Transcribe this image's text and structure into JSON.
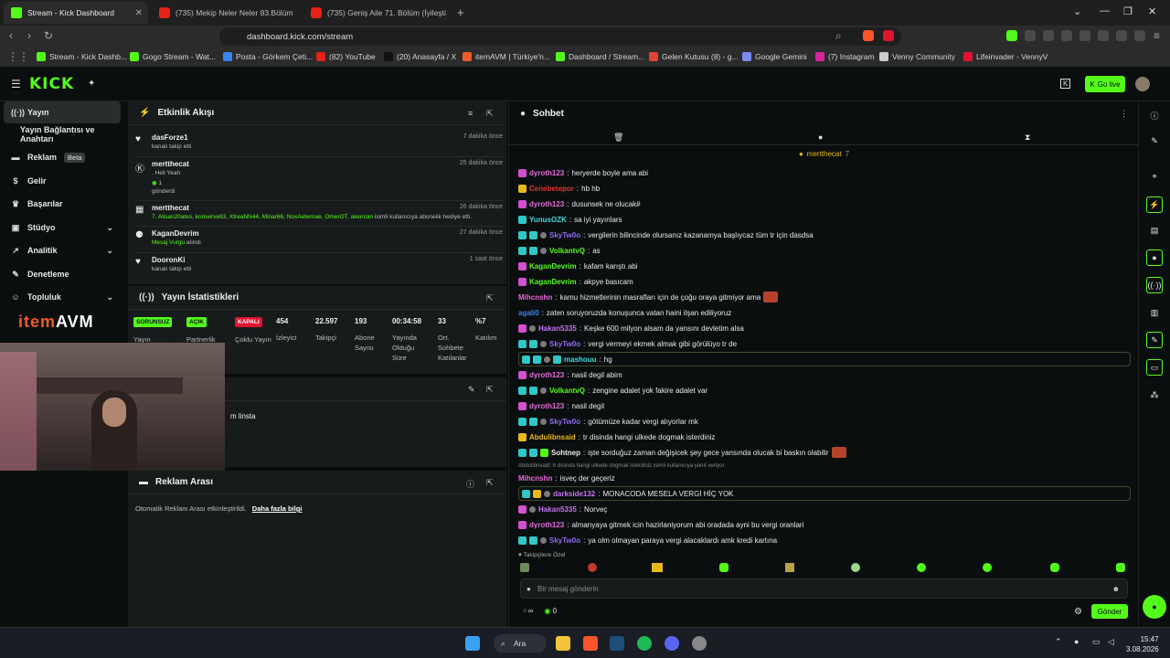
{
  "browser": {
    "tabs": [
      {
        "title": "Stream - Kick Dashboard",
        "icon": "kick-icon",
        "active": true
      },
      {
        "title": "(735) Mekip Neler Neler 83.Bölüm İz",
        "icon": "youtube-icon",
        "active": false
      },
      {
        "title": "(735) Geniş Aile 71. Bölüm (İyileştirile",
        "icon": "youtube-icon",
        "active": false
      }
    ],
    "url": "dashboard.kick.com/stream",
    "bookmarks": [
      "Stream - Kick Dashb...",
      "Gogo Stream - Wat...",
      "Posta - Görkem Çeti...",
      "(82) YouTube",
      "(20) Anasayfa / X",
      "itemAVM | Türkiye'n...",
      "Dashboard / Stream...",
      "Gelen Kutusu (8) - g...",
      "Google Gemini",
      "(7) Instagram",
      "Venny Community",
      "Lifeinvader - VennyV"
    ]
  },
  "header": {
    "logo": "KICK",
    "go_live": "Go live"
  },
  "sidebar": {
    "items": [
      {
        "label": "Yayın",
        "icon": "broadcast-icon"
      },
      {
        "label": "Yayın Bağlantısı ve Anahtarı",
        "icon": ""
      },
      {
        "label": "Reklam",
        "icon": "ad-icon",
        "badge": "Beta"
      },
      {
        "label": "Gelir",
        "icon": "dollar-icon"
      },
      {
        "label": "Başarılar",
        "icon": "trophy-icon"
      },
      {
        "label": "Stüdyo",
        "icon": "studio-icon"
      },
      {
        "label": "Analitik",
        "icon": "chart-icon"
      },
      {
        "label": "Denetleme",
        "icon": "wrench-icon"
      },
      {
        "label": "Topluluk",
        "icon": "community-icon"
      }
    ]
  },
  "activity": {
    "title": "Etkinlik Akışı",
    "items": [
      {
        "name": "dasForze1",
        "time": "7 dakika önce",
        "sub": "kanalı takip etti",
        "icon": "heart-icon"
      },
      {
        "name": "mertthecat",
        "time": "25 dakika önce",
        "sub1": ". Hell Yeah",
        "sub2": "1",
        "sub3": "gönderdi",
        "icon": "kick-icon"
      },
      {
        "name": "mertthecat",
        "time": "26 dakika önce",
        "users": "7, Alisan20ates, konserve63, XtreaNN44, Minar66, NoxAeternae, OmerOT, awurcan",
        "sub": " isimli kullanıcıya abonelik hediye etti.",
        "icon": "gift-icon"
      },
      {
        "name": "KaganDevrim",
        "time": "27 dakika önce",
        "reward": "Mesaj Vurgu",
        "sub": " alındı",
        "icon": "reward-icon"
      },
      {
        "name": "DooronKi",
        "time": "1 saat önce",
        "sub": "kanalı takip etti",
        "icon": "heart-icon"
      }
    ]
  },
  "stats": {
    "title": "Yayın İstatistikleri",
    "pills": [
      {
        "text": "SORUNSUZ",
        "label": "Yayın",
        "color": "#53fc18"
      },
      {
        "text": "AÇIK",
        "label": "Partnerlik",
        "color": "#53fc18"
      },
      {
        "text": "KAPALI",
        "label": "Çoklu Yayın",
        "color": "#e0142f"
      }
    ],
    "values": [
      {
        "value": "454",
        "label": "İzleyici"
      },
      {
        "value": "22.597",
        "label": "Takipçi"
      },
      {
        "value": "193",
        "label": "Abone Sayısı"
      },
      {
        "value": "00:34:58",
        "label": "Yayında Olduğu Süre"
      },
      {
        "value": "33",
        "label": "Ort. Sohbete Katılanlar"
      },
      {
        "value": "%7",
        "label": "Katılım"
      }
    ]
  },
  "info_panel": {
    "text": "m linsta"
  },
  "ads": {
    "title": "Reklam Arası",
    "text": "Otomatik Reklam Arası etkinleştirildi.",
    "link": "Daha fazla bilgi"
  },
  "overlay": {
    "logo_item": "item",
    "logo_avm": "AVM"
  },
  "chat": {
    "title": "Sohbet",
    "pinned_user": "mertthecat",
    "pinned_count": "7",
    "messages": [
      {
        "user": "dyroth123",
        "color": "#e46cd7",
        "badges": [
          "pink"
        ],
        "text": "heryerde boyle ama abi"
      },
      {
        "user": "Cenebetepor",
        "color": "#e2362f",
        "badges": [
          "gold"
        ],
        "text": "hb hb"
      },
      {
        "user": "dyroth123",
        "color": "#e46cd7",
        "badges": [
          "pink"
        ],
        "text": "dusunsek ne olucak#"
      },
      {
        "user": "YunusOZK",
        "color": "#45d9e0",
        "badges": [
          "teal"
        ],
        "text": "sa iyi yayınlars"
      },
      {
        "user": "SkyTw0o",
        "color": "#8f6bf0",
        "badges": [
          "teal",
          "teal",
          "grey"
        ],
        "text": "vergilerin bilincinde olursanız kazanamya başlıycaz tüm tr için dasdsa"
      },
      {
        "user": "VolkantvQ",
        "color": "#53fc18",
        "badges": [
          "teal",
          "teal",
          "grey"
        ],
        "text": "as"
      },
      {
        "user": "KaganDevrim",
        "color": "#53fc18",
        "badges": [
          "pink"
        ],
        "text": "kafam karıştı abi"
      },
      {
        "user": "KaganDevrim",
        "color": "#53fc18",
        "badges": [
          "pink"
        ],
        "text": "akpye basıcam"
      },
      {
        "user": "Mihcnshn",
        "color": "#e46cd7",
        "badges": [],
        "text": "kamu hizmetlerinin masrafları için de çoğu oraya gitmiyor ama"
      },
      {
        "user": "agali0",
        "color": "#3b83f0",
        "badges": [],
        "text": "zaten soruyoruzda konuşunca vatan haini ilşan ediliyoruz"
      },
      {
        "user": "Hakan5335",
        "color": "#c775f0",
        "badges": [
          "pink",
          "grey"
        ],
        "text": "Keşke 600 milyon alsam da yansını devletim alsa"
      },
      {
        "user": "SkyTw0o",
        "color": "#8f6bf0",
        "badges": [
          "teal",
          "teal",
          "grey"
        ],
        "text": "vergi vermeyi ekmek almak gibi görülüyo tr de"
      },
      {
        "user": "mashouu",
        "color": "#45d9e0",
        "badges": [
          "teal",
          "teal",
          "grey",
          "teal"
        ],
        "text": "hg"
      },
      {
        "user": "dyroth123",
        "color": "#e46cd7",
        "badges": [
          "pink"
        ],
        "text": "nasil degil abim"
      },
      {
        "user": "VolkantvQ",
        "color": "#53fc18",
        "badges": [
          "teal",
          "teal",
          "grey"
        ],
        "text": "zengine adalet yok fakire adalet var"
      },
      {
        "user": "dyroth123",
        "color": "#e46cd7",
        "badges": [
          "pink"
        ],
        "text": "nasil degil"
      },
      {
        "user": "SkyTw0o",
        "color": "#8f6bf0",
        "badges": [
          "teal",
          "teal",
          "grey"
        ],
        "text": "götümüze kadar vergi alıyorlar mk"
      },
      {
        "user": "Abdulibnsaid",
        "color": "#e8b81b",
        "badges": [
          "gold"
        ],
        "text": "tr disinda hangi ulkede dogmak isterdiniz"
      },
      {
        "user": "Sohtnep",
        "color": "#eaeaea",
        "badges": [
          "teal",
          "teal",
          "green"
        ],
        "text": "işte sorduğuz zaman değişicek şey gece yansında olucak bi baskın olabilir"
      },
      {
        "user": "Mihcnshn",
        "color": "#e46cd7",
        "badges": [],
        "text": "isveç der geçeriz",
        "reply": "Abdulibnsaid: tr disinda hangi ulkede dogmak isterdiniz isimli kullanıcıya yanıt veriyor"
      },
      {
        "user": "darkside132",
        "color": "#c775f0",
        "badges": [
          "teal",
          "gold",
          "grey"
        ],
        "text": "MONACODA MESELA VERGİ HİÇ YOK"
      },
      {
        "user": "Hakan5335",
        "color": "#c775f0",
        "badges": [
          "pink",
          "grey"
        ],
        "text": "Norveç"
      },
      {
        "user": "dyroth123",
        "color": "#e46cd7",
        "badges": [
          "pink"
        ],
        "text": "almanyaya gitmek icin hazirlaniyorum abi oradada ayni bu vergi oranlari"
      },
      {
        "user": "SkyTw0o",
        "color": "#8f6bf0",
        "badges": [
          "teal",
          "teal",
          "grey"
        ],
        "text": "ya olm olmayan paraya vergi alacaklardı amk kredi kartına"
      }
    ],
    "followers_only": "Takipçilere Özel",
    "input_placeholder": "Bir mesaj gönderin",
    "points": "0",
    "send": "Gönder"
  },
  "taskbar": {
    "search": "Ara",
    "time": "15:47",
    "date": "3.08.2026"
  }
}
